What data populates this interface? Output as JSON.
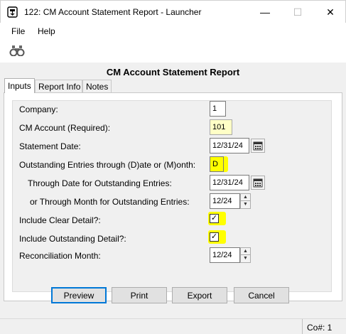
{
  "window": {
    "title": "122: CM Account Statement Report - Launcher",
    "minimize": "—",
    "maximize": "☐",
    "close": "✕"
  },
  "menu": {
    "file": "File",
    "help": "Help"
  },
  "toolbar": {
    "find_icon": "binoculars-icon"
  },
  "report_title": "CM Account Statement Report",
  "tabs": [
    {
      "label": "Inputs",
      "active": true
    },
    {
      "label": "Report Info",
      "active": false
    },
    {
      "label": "Notes",
      "active": false
    }
  ],
  "form": {
    "company": {
      "label": "Company:",
      "value": "1"
    },
    "cm_account": {
      "label": "CM Account (Required):",
      "value": "101"
    },
    "statement_date": {
      "label": "Statement Date:",
      "value": "12/31/24"
    },
    "outstanding_through": {
      "label": "Outstanding Entries through (D)ate or (M)onth:",
      "value": "D"
    },
    "through_date": {
      "label": "Through Date for Outstanding Entries:",
      "value": "12/31/24"
    },
    "through_month": {
      "label": "or Through Month for Outstanding Entries:",
      "value": "12/24"
    },
    "include_clear": {
      "label": "Include Clear Detail?:",
      "checked": true,
      "mark": "✓"
    },
    "include_outstanding": {
      "label": "Include Outstanding Detail?:",
      "checked": true,
      "mark": "✓"
    },
    "reconciliation_month": {
      "label": "Reconciliation Month:",
      "value": "12/24"
    }
  },
  "buttons": {
    "preview": "Preview",
    "print": "Print",
    "export": "Export",
    "cancel": "Cancel"
  },
  "status": {
    "company_no": "Co#: 1"
  },
  "colors": {
    "highlight": "#ffff00",
    "required_field": "#ffffc6",
    "default_button_border": "#0078d7"
  }
}
